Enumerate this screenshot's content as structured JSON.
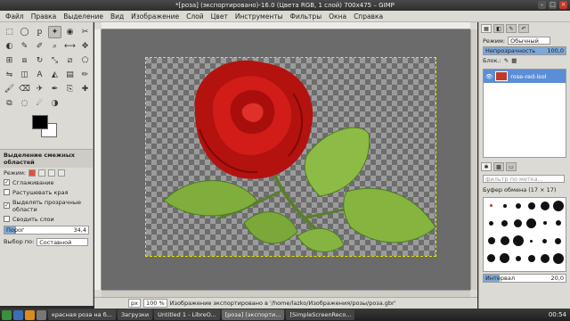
{
  "window": {
    "title": "*[роза] (экспортировано)-16.0 (Цвета RGB, 1 слой) 700x475 – GIMP",
    "buttons": [
      "–",
      "□",
      "×"
    ]
  },
  "menu": [
    "Файл",
    "Правка",
    "Выделение",
    "Вид",
    "Изображение",
    "Слой",
    "Цвет",
    "Инструменты",
    "Фильтры",
    "Окна",
    "Справка"
  ],
  "toolbox": {
    "tools": [
      "rect-select",
      "ellipse-select",
      "free-select",
      "fuzzy-select",
      "color-select",
      "scissors",
      "foreground-select",
      "paths",
      "color-picker",
      "zoom",
      "measure",
      "move",
      "align",
      "crop",
      "rotate",
      "scale",
      "shear",
      "perspective",
      "flip",
      "cage",
      "text",
      "bucket-fill",
      "blend",
      "pencil",
      "paintbrush",
      "eraser",
      "airbrush",
      "ink",
      "clone",
      "heal",
      "perspective-clone",
      "blur",
      "smudge",
      "dodge-burn"
    ],
    "tool_glyphs": [
      "⬚",
      "◯",
      "ꝑ",
      "✦",
      "◉",
      "✂",
      "◐",
      "✎",
      "✐",
      "⌕",
      "⟷",
      "✥",
      "⊞",
      "⧈",
      "↻",
      "⤡",
      "⧄",
      "⬠",
      "⇋",
      "◫",
      "A",
      "◭",
      "▤",
      "✏",
      "🖌",
      "⌫",
      "✈",
      "✒",
      "⎘",
      "✚",
      "⧉",
      "◌",
      "☄",
      "◑"
    ],
    "active_tool_index": 3,
    "fg_color": "#000000",
    "bg_color": "#ffffff",
    "options_title": "Выделение смежных областей",
    "mode_label": "Режим:",
    "antialias_label": "Сглаживание",
    "antialias": true,
    "feather_label": "Растушевать края",
    "feather": false,
    "transparent_label": "Выделять прозрачные области",
    "transparent": true,
    "merged_label": "Сводить слои",
    "merged": false,
    "threshold_label": "Порог",
    "threshold_value": "34,4",
    "threshold_fraction": 0.134,
    "select_by_label": "Выбор по:",
    "select_by_value": "Составной"
  },
  "statusbar": {
    "unit": "px",
    "zoom": "100 %",
    "message": "Изображение экспортировано в '/home/lazko/Изображения/розы/роза.gbr'"
  },
  "dock": {
    "mode_label": "Режим:",
    "mode_value": "Обычный",
    "opacity_label": "Непрозрачность",
    "opacity_value": "100,0",
    "opacity_fraction": 1.0,
    "lock_label": "Блок.:",
    "layers": [
      {
        "name": "rose-red-isol",
        "visible": true
      }
    ],
    "brushes_filter": "фильтр по метка...",
    "brush_title": "Буфер обмена (17 × 17)",
    "spacing_label": "Интервал",
    "spacing_value": "20,0",
    "spacing_fraction": 0.2
  },
  "taskbar": {
    "tasks": [
      {
        "label": "красная роза на б...",
        "active": false
      },
      {
        "label": "Загрузки",
        "active": false
      },
      {
        "label": "Untitled 1 - LibreO...",
        "active": false
      },
      {
        "label": "[роза] (экспорти...",
        "active": true
      },
      {
        "label": "[SimpleScreenReco...",
        "active": false
      }
    ],
    "clock": "00:54"
  }
}
